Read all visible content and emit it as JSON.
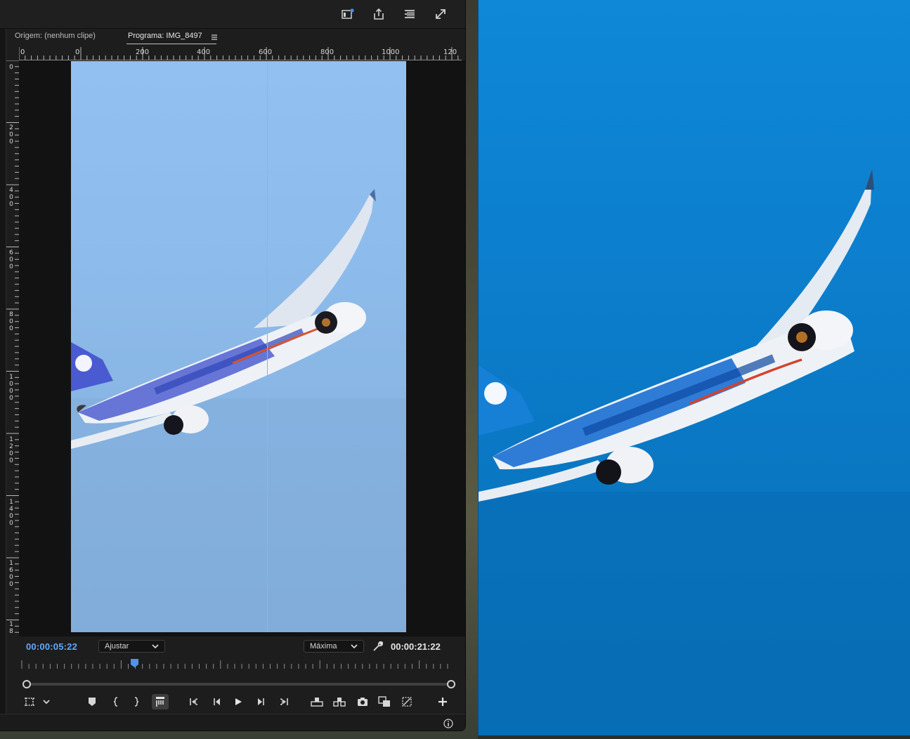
{
  "panel_tabs": {
    "source": "Origem: (nenhum clipe)",
    "program": "Programa: IMG_8497"
  },
  "ruler": {
    "top_labels": [
      "0",
      "0",
      "200",
      "400",
      "600",
      "800",
      "1000",
      "120"
    ],
    "left_labels": [
      "0",
      "200",
      "400",
      "600",
      "800",
      "1000",
      "1200",
      "1400",
      "1600",
      "18"
    ]
  },
  "transport": {
    "current_timecode": "00:00:05:22",
    "duration_timecode": "00:00:21:22",
    "zoom_select": "Ajustar",
    "quality_select": "Máxima"
  },
  "colors": {
    "accent_blue": "#5fa9ff",
    "guide_cyan": "#46d8e6",
    "panel_bg": "#1d1d1d"
  },
  "icons": {
    "toolbar": [
      "workspace-icon",
      "share-icon",
      "panel-menu-icon",
      "fullscreen-icon"
    ],
    "controls": [
      "safe-margins-icon",
      "chevron-down-icon",
      "add-marker-icon",
      "mark-in-icon",
      "mark-out-icon",
      "toggle-markers-icon",
      "go-to-in-icon",
      "step-back-icon",
      "play-icon",
      "step-forward-icon",
      "go-to-out-icon",
      "lift-icon",
      "extract-icon",
      "export-frame-icon",
      "comparison-view-icon",
      "proxy-toggle-icon",
      "button-editor-icon"
    ],
    "status": [
      "info-icon"
    ]
  }
}
